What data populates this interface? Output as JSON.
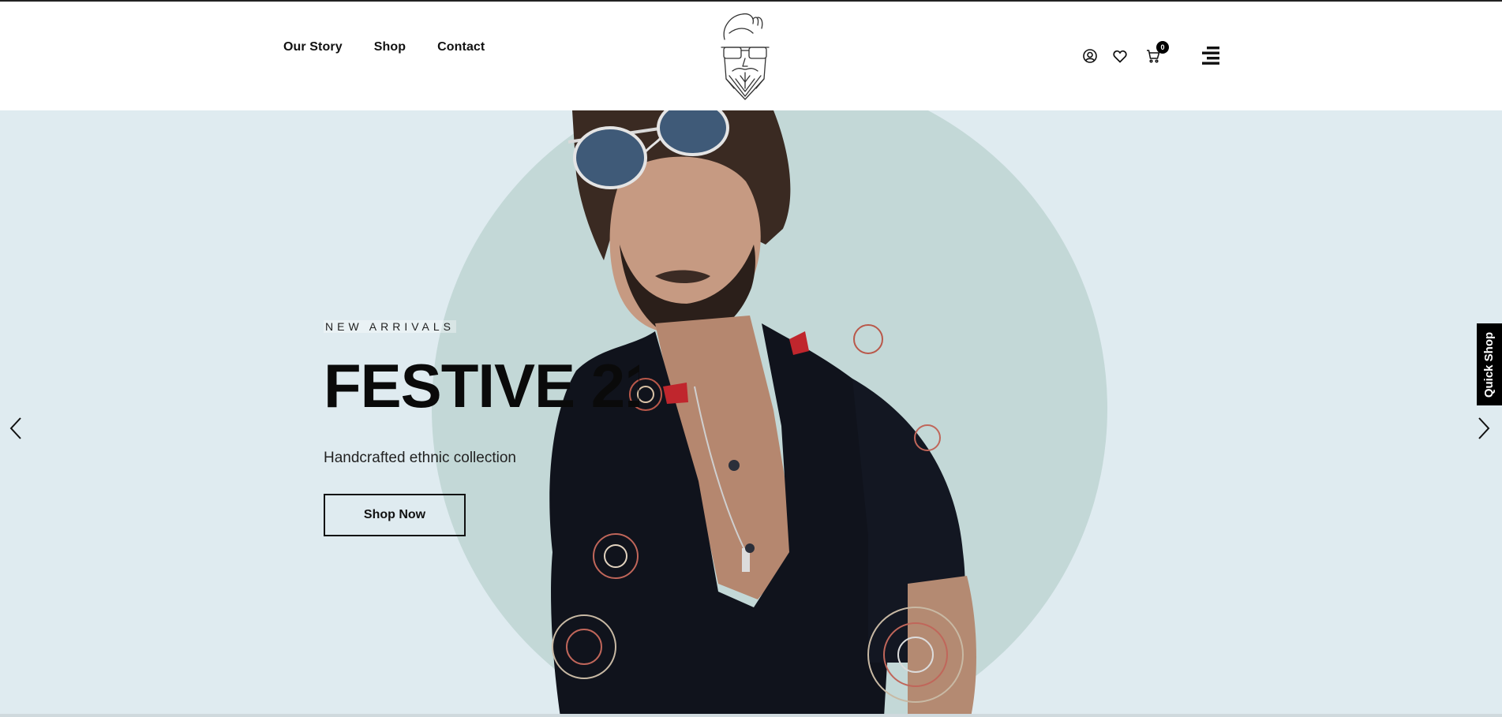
{
  "nav": {
    "items": [
      {
        "label": "Our Story"
      },
      {
        "label": "Shop"
      },
      {
        "label": "Contact"
      }
    ]
  },
  "header_icons": {
    "account": "user-circle-icon",
    "wishlist": "heart-icon",
    "cart": "cart-icon",
    "cart_count": "0",
    "menu": "hamburger-menu-icon"
  },
  "hero": {
    "kicker": "NEW ARRIVALS",
    "title": "FESTIVE 21",
    "subtitle": "Handcrafted ethnic collection",
    "cta_label": "Shop Now"
  },
  "quick_shop": {
    "label": "Quick Shop"
  },
  "colors": {
    "hero_bg": "#dfebf0",
    "circle": "#c3d8d7",
    "text": "#0a0a0a"
  }
}
